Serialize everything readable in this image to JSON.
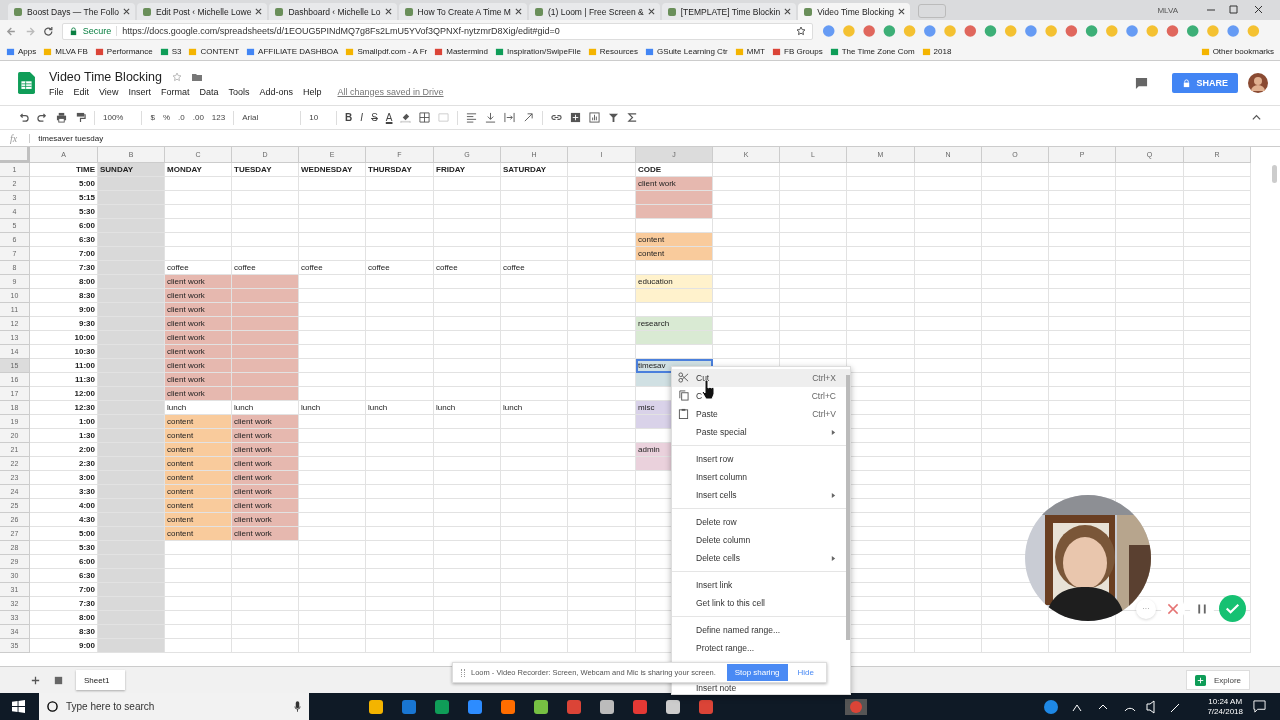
{
  "browser": {
    "profile": "MLVA",
    "tabs": [
      {
        "title": "Boost Days — The Follo",
        "selected": false
      },
      {
        "title": "Edit Post ‹ Michelle Lowe",
        "selected": false
      },
      {
        "title": "Dashboard ‹ Michelle Lo",
        "selected": false
      },
      {
        "title": "How To Create A Time M",
        "selected": false
      },
      {
        "title": "(1) Loom | Free Screen &",
        "selected": false
      },
      {
        "title": "[TEMPLATE] Time Blockin",
        "selected": false
      },
      {
        "title": "Video Time Blocking",
        "selected": true
      }
    ],
    "secure": "Secure",
    "url": "https://docs.google.com/spreadsheets/d/1EOUG5PINdMQ7g8Fs2LmU5YVof3QPNXf-nytzmrD8Xig/edit#gid=0",
    "bookmarks": [
      "Apps",
      "MLVA FB",
      "Performance",
      "S3",
      "CONTENT",
      "AFFILIATE DASHBOA",
      "Smallpdf.com - A Fr",
      "Mastermind",
      "Inspiration/SwipeFile",
      "Resources",
      "GSuite Learning Ctr",
      "MMT",
      "FB Groups",
      "The Time Zone Com",
      "2018"
    ],
    "other_bookmarks": "Other bookmarks"
  },
  "doc": {
    "title": "Video Time Blocking",
    "menus": [
      "File",
      "Edit",
      "View",
      "Insert",
      "Format",
      "Data",
      "Tools",
      "Add-ons",
      "Help"
    ],
    "save_status": "All changes saved in Drive",
    "share": "SHARE"
  },
  "toolbar": {
    "zoom": "100%",
    "number_formats": [
      "$",
      "%",
      ".0",
      ".00",
      "123"
    ],
    "font": "Arial",
    "size": "10",
    "styles": [
      "B",
      "I",
      "S",
      "A"
    ]
  },
  "formula_bar": {
    "label": "fx",
    "value": "timesaver tuesday"
  },
  "grid": {
    "columns": [
      "A",
      "B",
      "C",
      "D",
      "E",
      "F",
      "G",
      "H",
      "I",
      "J",
      "K",
      "L",
      "M",
      "N",
      "O",
      "P",
      "Q",
      "R"
    ],
    "rows": [
      {
        "num": "1",
        "cells": [
          {
            "text": "TIME"
          },
          {
            "text": "SUNDAY",
            "color": "#d9d9d9"
          },
          {
            "text": "MONDAY"
          },
          {
            "text": "TUESDAY"
          },
          {
            "text": "WEDNESDAY"
          },
          {
            "text": "THURSDAY"
          },
          {
            "text": "FRIDAY"
          },
          {
            "text": "SATURDAY"
          },
          {},
          {
            "text": "CODE"
          }
        ]
      },
      {
        "num": "2",
        "cells": [
          {
            "text": "5:00"
          },
          {
            "color": "#d9d9d9"
          },
          {},
          {},
          {},
          {},
          {},
          {},
          {},
          {
            "text": "client work",
            "color": "#e6b8af"
          }
        ]
      },
      {
        "num": "3",
        "cells": [
          {
            "text": "5:15"
          },
          {
            "color": "#d9d9d9"
          },
          {},
          {},
          {},
          {},
          {},
          {},
          {},
          {
            "color": "#e6b8af"
          }
        ]
      },
      {
        "num": "4",
        "cells": [
          {
            "text": "5:30"
          },
          {
            "color": "#d9d9d9"
          },
          {},
          {},
          {},
          {},
          {},
          {},
          {},
          {
            "color": "#e6b8af"
          }
        ]
      },
      {
        "num": "5",
        "cells": [
          {
            "text": "6:00"
          },
          {
            "color": "#d9d9d9"
          }
        ]
      },
      {
        "num": "6",
        "cells": [
          {
            "text": "6:30"
          },
          {
            "color": "#d9d9d9"
          },
          {},
          {},
          {},
          {},
          {},
          {},
          {},
          {
            "text": "content",
            "color": "#f9cb9c"
          }
        ]
      },
      {
        "num": "7",
        "cells": [
          {
            "text": "7:00"
          },
          {
            "color": "#d9d9d9"
          },
          {},
          {},
          {},
          {},
          {},
          {},
          {},
          {
            "text": "content",
            "color": "#f9cb9c"
          }
        ]
      },
      {
        "num": "8",
        "cells": [
          {
            "text": "7:30"
          },
          {
            "color": "#d9d9d9"
          },
          {
            "text": "coffee"
          },
          {
            "text": "coffee"
          },
          {
            "text": "coffee"
          },
          {
            "text": "coffee"
          },
          {
            "text": "coffee"
          },
          {
            "text": "coffee"
          }
        ]
      },
      {
        "num": "9",
        "cells": [
          {
            "text": "8:00"
          },
          {
            "color": "#d9d9d9"
          },
          {
            "text": "client work",
            "color": "#e6b8af"
          },
          {
            "color": "#e6b8af"
          },
          {},
          {},
          {},
          {},
          {},
          {
            "text": "education",
            "color": "#fff2cc"
          }
        ]
      },
      {
        "num": "10",
        "cells": [
          {
            "text": "8:30"
          },
          {
            "color": "#d9d9d9"
          },
          {
            "text": "client work",
            "color": "#e6b8af"
          },
          {
            "color": "#e6b8af"
          },
          {},
          {},
          {},
          {},
          {},
          {
            "color": "#fff2cc"
          }
        ]
      },
      {
        "num": "11",
        "cells": [
          {
            "text": "9:00"
          },
          {
            "color": "#d9d9d9"
          },
          {
            "text": "client work",
            "color": "#e6b8af"
          },
          {
            "color": "#e6b8af"
          }
        ]
      },
      {
        "num": "12",
        "cells": [
          {
            "text": "9:30"
          },
          {
            "color": "#d9d9d9"
          },
          {
            "text": "client work",
            "color": "#e6b8af"
          },
          {
            "color": "#e6b8af"
          },
          {},
          {},
          {},
          {},
          {},
          {
            "text": "research",
            "color": "#d9ead3"
          }
        ]
      },
      {
        "num": "13",
        "cells": [
          {
            "text": "10:00"
          },
          {
            "color": "#d9d9d9"
          },
          {
            "text": "client work",
            "color": "#e6b8af"
          },
          {
            "color": "#e6b8af"
          },
          {},
          {},
          {},
          {},
          {},
          {
            "color": "#d9ead3"
          }
        ]
      },
      {
        "num": "14",
        "cells": [
          {
            "text": "10:30"
          },
          {
            "color": "#d9d9d9"
          },
          {
            "text": "client work",
            "color": "#e6b8af"
          },
          {
            "color": "#e6b8af"
          }
        ]
      },
      {
        "num": "15",
        "cells": [
          {
            "text": "11:00"
          },
          {
            "color": "#d9d9d9"
          },
          {
            "text": "client work",
            "color": "#e6b8af"
          },
          {
            "color": "#e6b8af"
          },
          {},
          {},
          {},
          {},
          {},
          {
            "text": "timesav",
            "color": "#d0e0e3",
            "selected": true
          }
        ]
      },
      {
        "num": "16",
        "cells": [
          {
            "text": "11:30"
          },
          {
            "color": "#d9d9d9"
          },
          {
            "text": "client work",
            "color": "#e6b8af"
          },
          {
            "color": "#e6b8af"
          },
          {},
          {},
          {},
          {},
          {},
          {
            "color": "#d0e0e3"
          }
        ]
      },
      {
        "num": "17",
        "cells": [
          {
            "text": "12:00"
          },
          {
            "color": "#d9d9d9"
          },
          {
            "text": "client work",
            "color": "#e6b8af"
          },
          {
            "color": "#e6b8af"
          }
        ]
      },
      {
        "num": "18",
        "cells": [
          {
            "text": "12:30"
          },
          {
            "color": "#d9d9d9"
          },
          {
            "text": "lunch"
          },
          {
            "text": "lunch"
          },
          {
            "text": "lunch"
          },
          {
            "text": "lunch"
          },
          {
            "text": "lunch"
          },
          {
            "text": "lunch"
          },
          {},
          {
            "text": "misc",
            "color": "#d9d2e9"
          }
        ]
      },
      {
        "num": "19",
        "cells": [
          {
            "text": "1:00"
          },
          {
            "color": "#d9d9d9"
          },
          {
            "text": "content",
            "color": "#f9cb9c"
          },
          {
            "text": "client work",
            "color": "#e6b8af"
          },
          {},
          {},
          {},
          {},
          {},
          {
            "color": "#d9d2e9"
          }
        ]
      },
      {
        "num": "20",
        "cells": [
          {
            "text": "1:30"
          },
          {
            "color": "#d9d9d9"
          },
          {
            "text": "content",
            "color": "#f9cb9c"
          },
          {
            "text": "client work",
            "color": "#e6b8af"
          }
        ]
      },
      {
        "num": "21",
        "cells": [
          {
            "text": "2:00"
          },
          {
            "color": "#d9d9d9"
          },
          {
            "text": "content",
            "color": "#f9cb9c"
          },
          {
            "text": "client work",
            "color": "#e6b8af"
          },
          {},
          {},
          {},
          {},
          {},
          {
            "text": "admin",
            "color": "#ead1dc"
          }
        ]
      },
      {
        "num": "22",
        "cells": [
          {
            "text": "2:30"
          },
          {
            "color": "#d9d9d9"
          },
          {
            "text": "content",
            "color": "#f9cb9c"
          },
          {
            "text": "client work",
            "color": "#e6b8af"
          },
          {},
          {},
          {},
          {},
          {},
          {
            "color": "#ead1dc"
          }
        ]
      },
      {
        "num": "23",
        "cells": [
          {
            "text": "3:00"
          },
          {
            "color": "#d9d9d9"
          },
          {
            "text": "content",
            "color": "#f9cb9c"
          },
          {
            "text": "client work",
            "color": "#e6b8af"
          }
        ]
      },
      {
        "num": "24",
        "cells": [
          {
            "text": "3:30"
          },
          {
            "color": "#d9d9d9"
          },
          {
            "text": "content",
            "color": "#f9cb9c"
          },
          {
            "text": "client work",
            "color": "#e6b8af"
          }
        ]
      },
      {
        "num": "25",
        "cells": [
          {
            "text": "4:00"
          },
          {
            "color": "#d9d9d9"
          },
          {
            "text": "content",
            "color": "#f9cb9c"
          },
          {
            "text": "client work",
            "color": "#e6b8af"
          }
        ]
      },
      {
        "num": "26",
        "cells": [
          {
            "text": "4:30"
          },
          {
            "color": "#d9d9d9"
          },
          {
            "text": "content",
            "color": "#f9cb9c"
          },
          {
            "text": "client work",
            "color": "#e6b8af"
          }
        ]
      },
      {
        "num": "27",
        "cells": [
          {
            "text": "5:00"
          },
          {
            "color": "#d9d9d9"
          },
          {
            "text": "content",
            "color": "#f9cb9c"
          },
          {
            "text": "client work",
            "color": "#e6b8af"
          }
        ]
      },
      {
        "num": "28",
        "cells": [
          {
            "text": "5:30"
          },
          {
            "color": "#d9d9d9"
          }
        ]
      },
      {
        "num": "29",
        "cells": [
          {
            "text": "6:00"
          },
          {
            "color": "#d9d9d9"
          }
        ]
      },
      {
        "num": "30",
        "cells": [
          {
            "text": "6:30"
          },
          {
            "color": "#d9d9d9"
          }
        ]
      },
      {
        "num": "31",
        "cells": [
          {
            "text": "7:00"
          },
          {
            "color": "#d9d9d9"
          }
        ]
      },
      {
        "num": "32",
        "cells": [
          {
            "text": "7:30"
          },
          {
            "color": "#d9d9d9"
          }
        ]
      },
      {
        "num": "33",
        "cells": [
          {
            "text": "8:00"
          },
          {
            "color": "#d9d9d9"
          }
        ]
      },
      {
        "num": "34",
        "cells": [
          {
            "text": "8:30"
          },
          {
            "color": "#d9d9d9"
          }
        ]
      },
      {
        "num": "35",
        "cells": [
          {
            "text": "9:00"
          },
          {
            "color": "#d9d9d9"
          }
        ]
      }
    ]
  },
  "context_menu": {
    "groups": [
      [
        {
          "label": "Cut",
          "shortcut": "Ctrl+X",
          "kind": "cut",
          "selected": true
        },
        {
          "label": "C",
          "shortcut": "Ctrl+C",
          "kind": "copy",
          "selected": false
        },
        {
          "label": "Paste",
          "shortcut": "Ctrl+V",
          "kind": "paste",
          "selected": false
        },
        {
          "label": "Paste special",
          "submenu": true,
          "selected": false
        }
      ],
      [
        {
          "label": "Insert row",
          "selected": false
        },
        {
          "label": "Insert column",
          "selected": false
        },
        {
          "label": "Insert cells",
          "submenu": true,
          "selected": false
        }
      ],
      [
        {
          "label": "Delete row",
          "selected": false
        },
        {
          "label": "Delete column",
          "selected": false
        },
        {
          "label": "Delete cells",
          "submenu": true,
          "selected": false
        }
      ],
      [
        {
          "label": "Insert link",
          "selected": false
        },
        {
          "label": "Get link to this cell",
          "selected": false
        }
      ],
      [
        {
          "label": "Define named range...",
          "selected": false
        },
        {
          "label": "Protect range...",
          "selected": false
        }
      ],
      [
        {
          "label": "Insert note",
          "selected": false
        }
      ]
    ]
  },
  "sheet_tabs": [
    {
      "label": "Sheet1",
      "selected": true
    }
  ],
  "explore": "Explore",
  "loom_bar": {
    "message": "Loom - Video Recorder: Screen, Webcam and Mic is sharing your screen.",
    "stop": "Stop sharing",
    "hide": "Hide"
  },
  "loom_controls": {
    "more": "···"
  },
  "taskbar": {
    "search": "Type here to search",
    "time": "10:24 AM",
    "date": "7/24/2018"
  }
}
